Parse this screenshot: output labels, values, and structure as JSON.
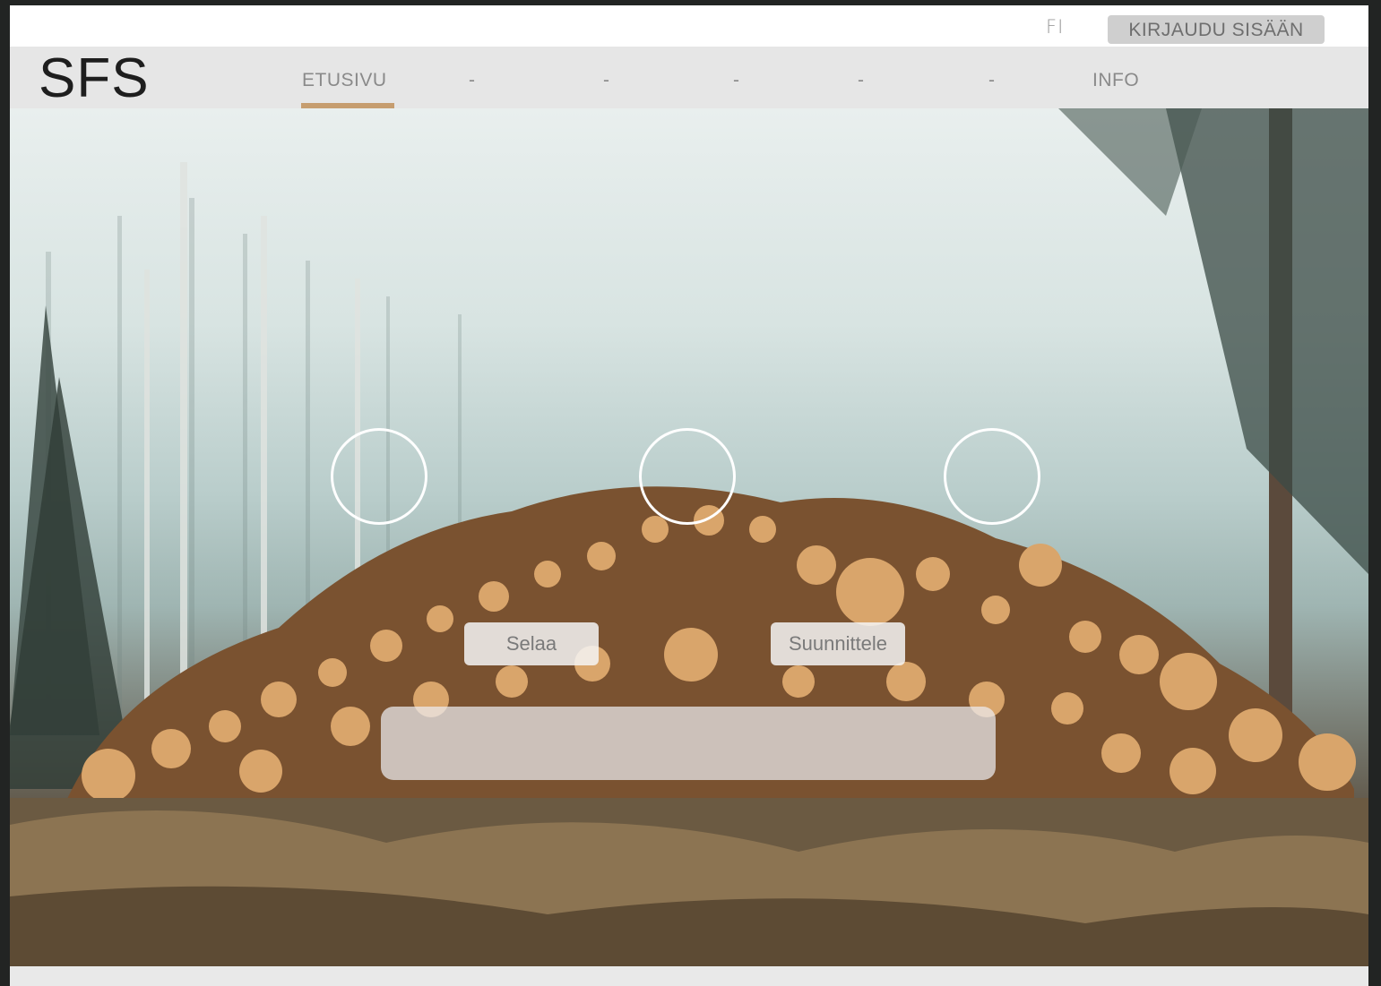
{
  "topbar": {
    "language": "FI",
    "login_label": "KIRJAUDU SISÄÄN"
  },
  "navbar": {
    "logo": "SFS",
    "items": [
      {
        "label": "ETUSIVU",
        "active": true
      },
      {
        "label": "-",
        "active": false
      },
      {
        "label": "-",
        "active": false
      },
      {
        "label": "-",
        "active": false
      },
      {
        "label": "-",
        "active": false
      },
      {
        "label": "-",
        "active": false
      },
      {
        "label": "INFO",
        "active": false
      }
    ],
    "accent_color": "#c69d6f"
  },
  "hero": {
    "circle_icons": [
      "circle-icon",
      "circle-icon",
      "circle-icon"
    ],
    "buttons": {
      "browse_label": "Selaa",
      "design_label": "Suunnittele"
    },
    "search_value": "",
    "search_placeholder": ""
  }
}
